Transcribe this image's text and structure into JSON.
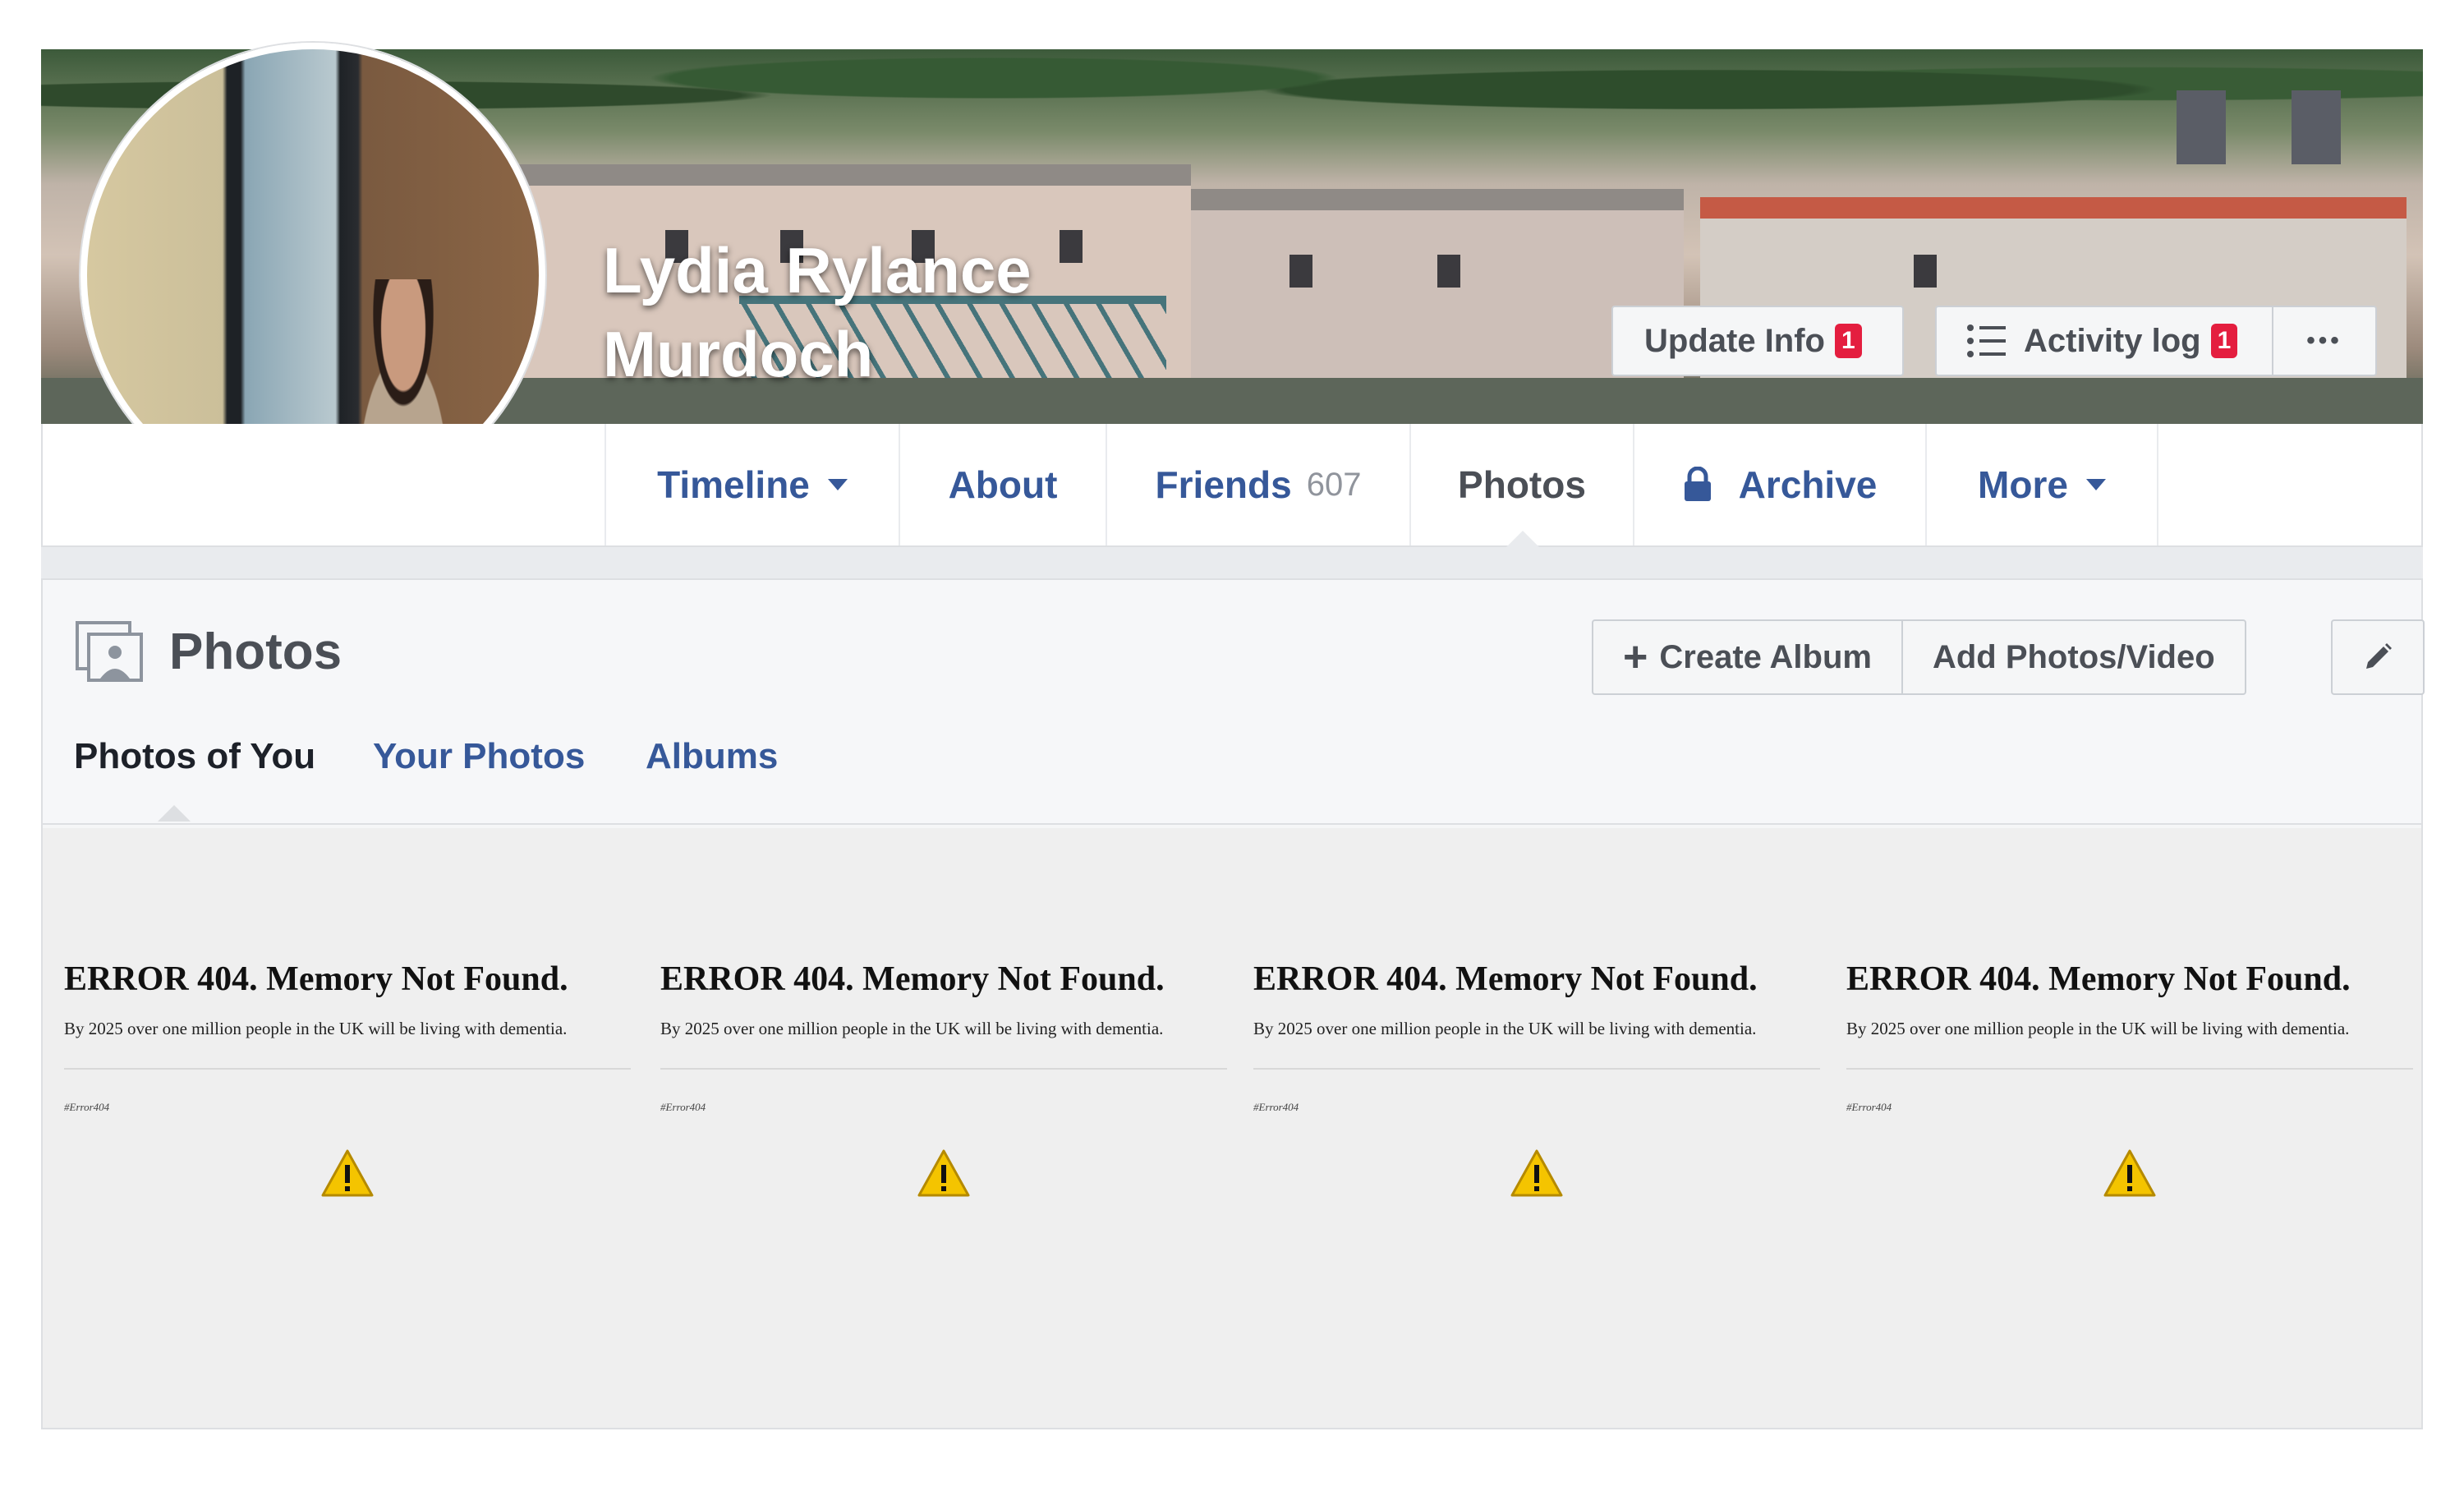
{
  "profile": {
    "name_line1": "Lydia Rylance",
    "name_line2": "Murdoch",
    "update_info_label": "Update Info",
    "update_info_badge": "1",
    "activity_log_label": "Activity log",
    "activity_log_badge": "1",
    "more_dots": "•••"
  },
  "nav": {
    "timeline": "Timeline",
    "about": "About",
    "friends": "Friends",
    "friends_count": "607",
    "photos": "Photos",
    "archive": "Archive",
    "more": "More"
  },
  "photos_section": {
    "title": "Photos",
    "create_album": "Create Album",
    "add_photos": "Add Photos/Video",
    "tabs": [
      "Photos of You",
      "Your Photos",
      "Albums"
    ]
  },
  "photo_cards": [
    {
      "title": "ERROR 404. Memory Not Found.",
      "subtitle": "By 2025 over one million people in the UK will be living with dementia.",
      "tag": "#Error404"
    },
    {
      "title": "ERROR 404. Memory Not Found.",
      "subtitle": "By 2025 over one million people in the UK will be living with dementia.",
      "tag": "#Error404"
    },
    {
      "title": "ERROR 404. Memory Not Found.",
      "subtitle": "By 2025 over one million people in the UK will be living with dementia.",
      "tag": "#Error404"
    },
    {
      "title": "ERROR 404. Memory Not Found.",
      "subtitle": "By 2025 over one million people in the UK will be living with dementia.",
      "tag": "#Error404"
    }
  ],
  "colors": {
    "link": "#365899",
    "badge": "#e41e3f",
    "warning": "#f4c400"
  }
}
